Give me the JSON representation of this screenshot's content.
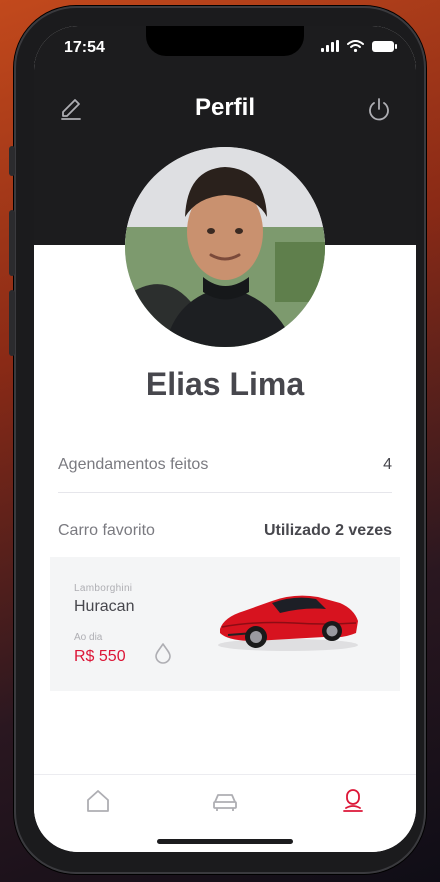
{
  "status_bar": {
    "time": "17:54"
  },
  "header": {
    "title": "Perfil"
  },
  "profile": {
    "name": "Elias Lima"
  },
  "stats": {
    "appointments_label": "Agendamentos feitos",
    "appointments_count": "4",
    "favorite_label": "Carro favorito",
    "favorite_usage": "Utilizado 2 vezes"
  },
  "favorite_car": {
    "brand": "Lamborghini",
    "model": "Huracan",
    "period": "Ao dia",
    "price": "R$ 550",
    "fuel_icon": "drop-icon"
  },
  "tabbar": {
    "tabs": [
      {
        "icon": "home-icon",
        "active": false
      },
      {
        "icon": "car-icon",
        "active": false
      },
      {
        "icon": "user-icon",
        "active": true
      }
    ]
  },
  "colors": {
    "header_bg": "#1c1c1e",
    "accent": "#dc1637",
    "card_bg": "#f4f5f6",
    "text_primary": "#47474d",
    "text_secondary": "#7a7a80"
  }
}
